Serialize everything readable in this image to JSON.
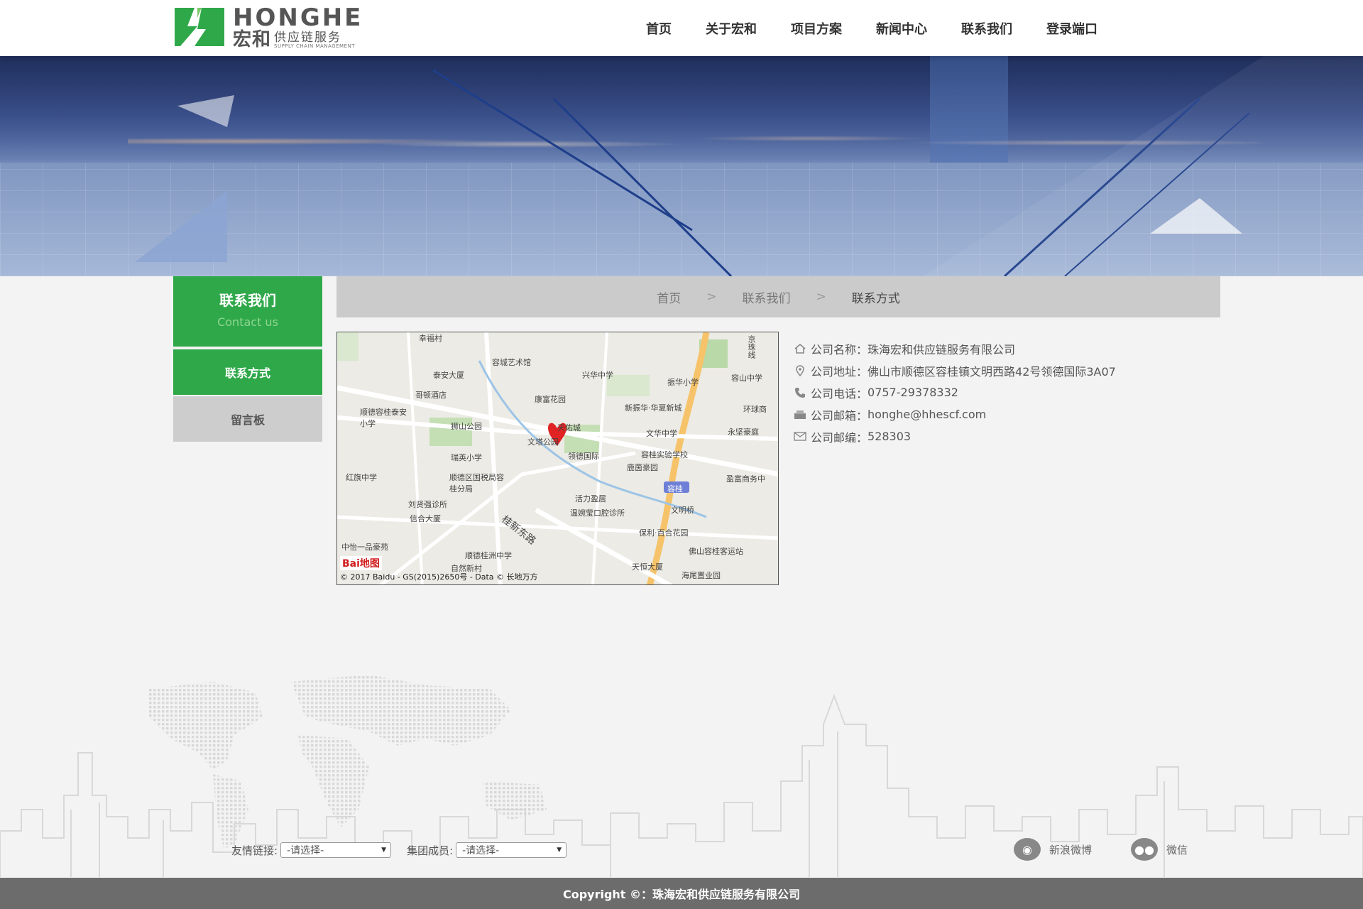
{
  "logo": {
    "en": "HONGHE",
    "cn": "宏和",
    "cn_sub": "供应链服务",
    "tagline": "SUPPLY CHAIN MANAGEMENT"
  },
  "nav": [
    "首页",
    "关于宏和",
    "项目方案",
    "新闻中心",
    "联系我们",
    "登录端口"
  ],
  "sidebar": {
    "title": "联系我们",
    "subtitle": "Contact us",
    "items": [
      "联系方式",
      "留言板"
    ]
  },
  "breadcrumb": {
    "home": "首页",
    "sep": ">",
    "parent": "联系我们",
    "current": "联系方式"
  },
  "map": {
    "labels": [
      "幸福村",
      "容城艺术馆",
      "泰安大厦",
      "兴华中学",
      "京珠线",
      "振华小学",
      "容山中学",
      "哥顿酒店",
      "康富花园",
      "新振华·华夏新城",
      "环球商",
      "顺德容桂泰安小学",
      "狮山公园",
      "天佑城",
      "文华中学",
      "永坚豪庭",
      "文塔公园",
      "瑞英小学",
      "领德国际",
      "容桂实验学校",
      "红旗中学",
      "鹿茵豪园",
      "顺德区国税局容桂分局",
      "容桂",
      "盈富商务中",
      "刘贤强诊所",
      "活力盈居",
      "文明桥",
      "信合大厦",
      "温婉莹口腔诊所",
      "桂新东路",
      "保利·百合花园",
      "中怡一品豪苑",
      "顺德桂洲中学",
      "佛山容桂客运站",
      "天恒大厦",
      "自然新村",
      "海尾置业园"
    ],
    "logo": "Bai地图",
    "copyright": "© 2017 Baidu - GS(2015)2650号 - Data © 长地万方"
  },
  "info": [
    {
      "icon": "home-icon",
      "label": "公司名称：",
      "value": "珠海宏和供应链服务有限公司"
    },
    {
      "icon": "location-icon",
      "label": "公司地址：",
      "value": "佛山市顺德区容桂镇文明西路42号领德国际3A07"
    },
    {
      "icon": "phone-icon",
      "label": "公司电话：",
      "value": "0757-29378332"
    },
    {
      "icon": "fax-icon",
      "label": "公司邮箱：",
      "value": "honghe@hhescf.com"
    },
    {
      "icon": "mail-icon",
      "label": "公司邮编：",
      "value": "528303"
    }
  ],
  "footer_links": {
    "friend_label": "友情链接:",
    "friend_value": "-请选择-",
    "group_label": "集团成员:",
    "group_value": "-请选择-"
  },
  "social": {
    "weibo": "新浪微博",
    "wechat": "微信"
  },
  "copyright": "Copyright ©：珠海宏和供应链服务有限公司",
  "colors": {
    "brand_green": "#2fa84a",
    "footer_gray": "#6c6c6c"
  }
}
